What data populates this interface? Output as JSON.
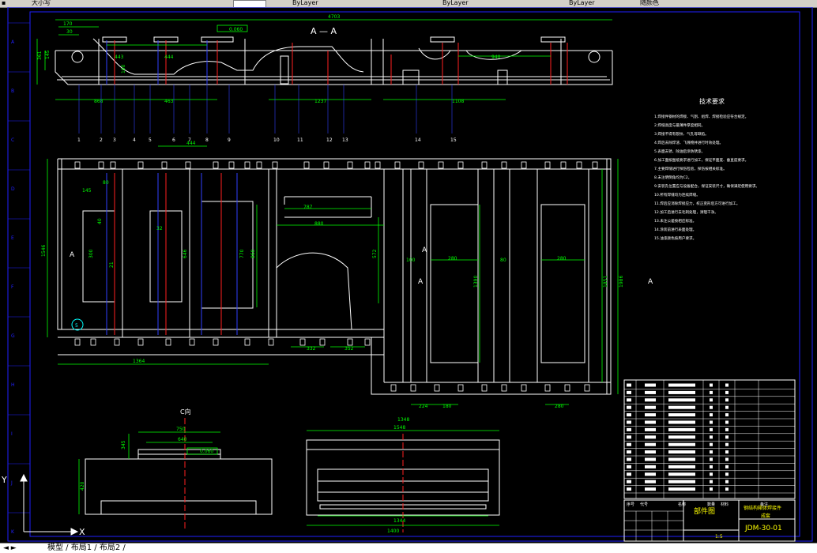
{
  "toolbar": {
    "items": [
      "大小写",
      "ByLayer",
      "ByLayer",
      "ByLayer",
      "随颜色"
    ]
  },
  "drawing": {
    "section_title": "A — A",
    "detail_title": "C向",
    "tech_title": "技术要求",
    "tech_lines": [
      "1.焊接件钢材的焊接、气割、组焊、焊接检验应符合规定。",
      "2.焊缝高度与最薄件厚度相同。",
      "3.焊接不得有裂纹、气孔等缺陷。",
      "4.焊后去除焊渣、飞溅物并进行时效处理。",
      "5.表面去锈、除油后涂防锈漆。",
      "6.加工面按图纸要求进行加工，保证平面度、垂直度要求。",
      "7.主要焊缝进行探伤检验，探伤按相关标准。",
      "8.未注明倒角均为C2。",
      "9.安装孔位置应与设备配合，保证安装尺寸，确保满足使用要求。",
      "10.所有焊缝均为连续焊缝。",
      "11.焊后应消除焊接应力，校正变形后方可进行加工。",
      "12.加工后进行去毛刺处理，清理干净。",
      "13.未注公差按相应标准。",
      "14.涂装前进行表面处理。",
      "15.油漆颜色按用户要求。"
    ],
    "dims_section": [
      "4703",
      "170",
      "30",
      "443",
      "444",
      "0.060",
      "940",
      "868",
      "463",
      "1237",
      "1108",
      "361",
      "160",
      "145"
    ],
    "dims_plan": [
      "444",
      "1364",
      "787",
      "880",
      "100",
      "280",
      "1390",
      "80",
      "280",
      "1851",
      "1986",
      "1546",
      "300",
      "770",
      "860",
      "646",
      "332",
      "352",
      "224",
      "180",
      "280",
      "21",
      "40",
      "32",
      "80",
      "145",
      "572"
    ],
    "dims_view_c": [
      "750",
      "640",
      "345",
      "0.060",
      "420"
    ],
    "dims_view_front": [
      "1348",
      "1548",
      "1344",
      "1400"
    ],
    "balloons_top": [
      "1",
      "2",
      "3",
      "4",
      "5",
      "6",
      "7",
      "8",
      "9",
      "10",
      "11",
      "12",
      "13",
      "14",
      "15"
    ],
    "plan_balloon": "5",
    "section_marks": [
      "A",
      "A",
      "A",
      "A"
    ],
    "grid_rows": [
      "A",
      "B",
      "C",
      "D",
      "E",
      "F",
      "G",
      "H",
      "I",
      "J",
      "K"
    ],
    "title_block": {
      "drawing_type": "部件图",
      "part_name": "钢结构箱体焊接件",
      "material": "成套",
      "drawing_no": "JDM-30-01",
      "headers": [
        "序号",
        "代号",
        "名称",
        "数量",
        "材料",
        "备注"
      ],
      "scale": "1:5"
    },
    "axis_labels": {
      "x": "X",
      "y": "Y"
    },
    "ucs_label": "Y"
  },
  "statusbar": {
    "nav_arrows": "◄ ►",
    "tabs_text": "模型 / 布局1 / 布局2 /"
  },
  "colors": {
    "background": "#000000",
    "lines": "#ffffff",
    "dimensions": "#00ff00",
    "centerlines": "#ff2020",
    "blue_lines": "#3040ff",
    "frame": "#2020ff",
    "text_yellow": "#ffff00",
    "text_cyan": "#00ffff"
  }
}
